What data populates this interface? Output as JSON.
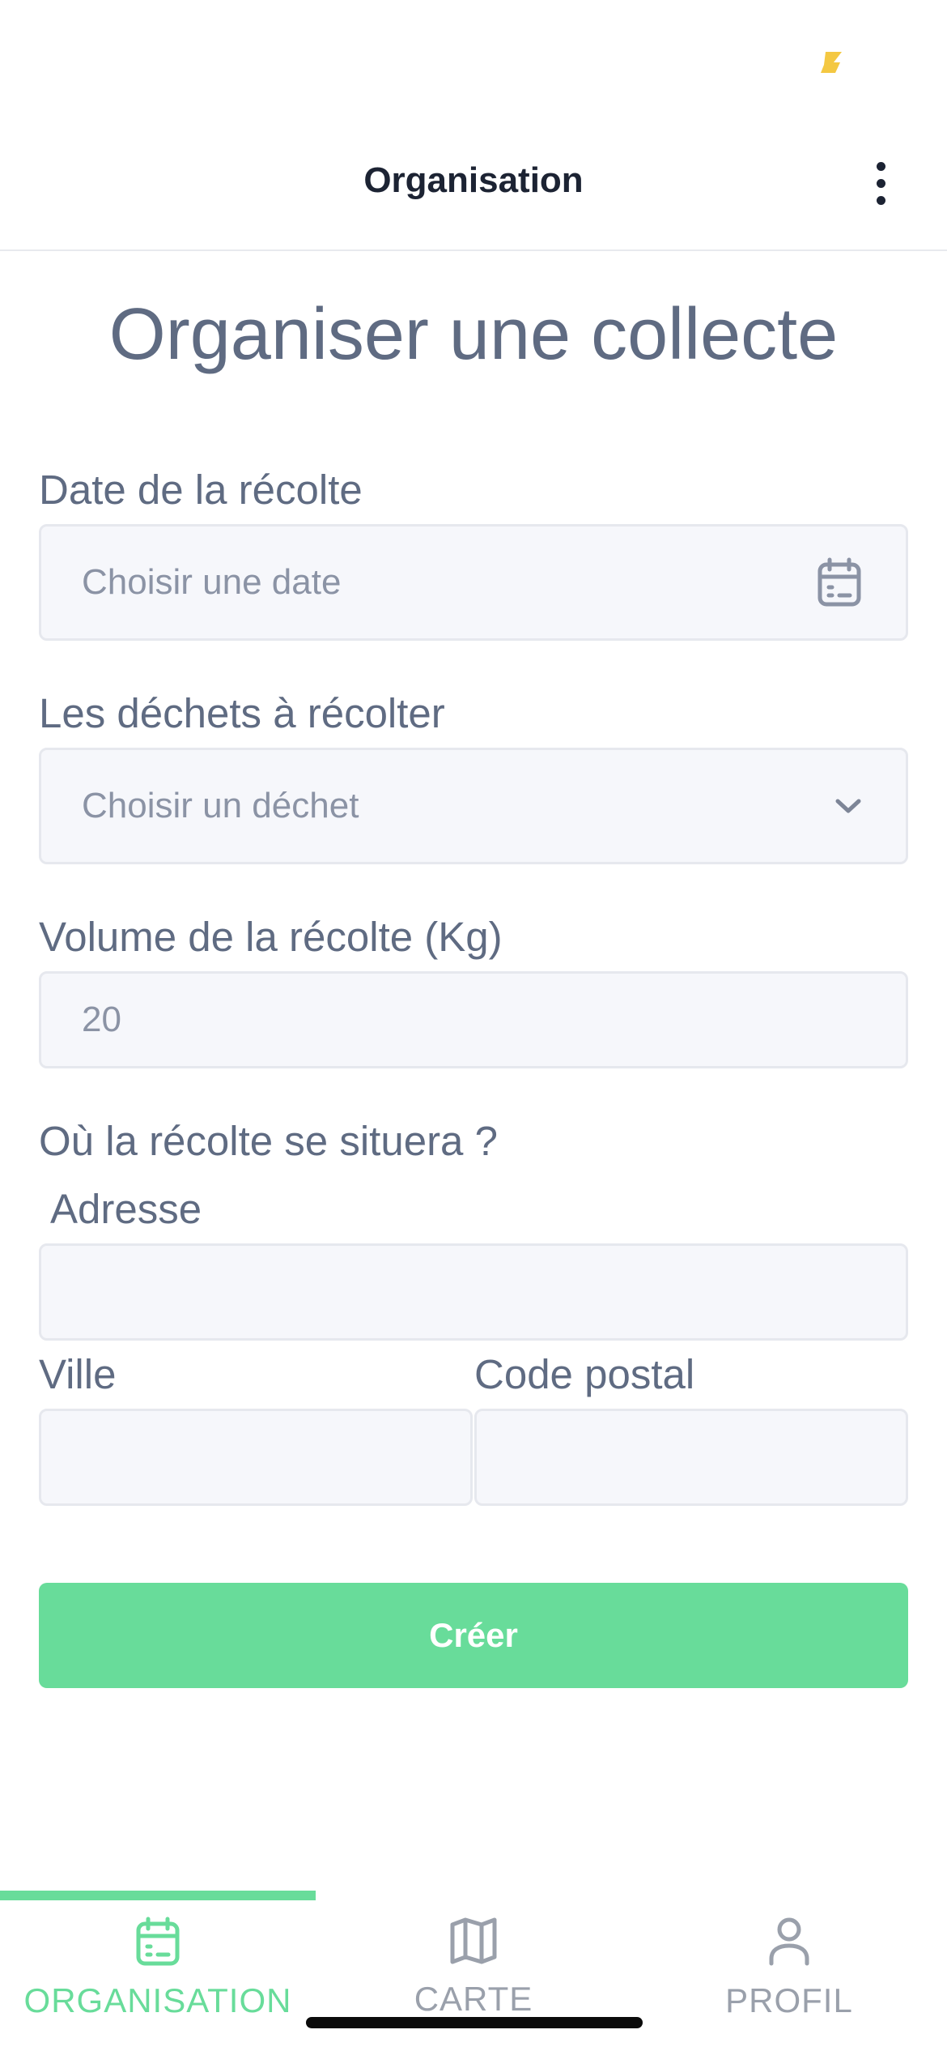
{
  "colors": {
    "accent": "#68dc9a",
    "text_primary": "#5f6b82",
    "header_text": "#1c2333",
    "input_bg": "#f6f7fb",
    "tab_inactive": "#9aa0ab",
    "status_indicator": "#f4c842"
  },
  "header": {
    "title": "Organisation",
    "menu_icon": "more-vertical-icon"
  },
  "form": {
    "title": "Organiser une collecte",
    "date": {
      "label": "Date de la récolte",
      "placeholder": "Choisir une date",
      "icon": "calendar-icon"
    },
    "waste": {
      "label": "Les déchets à récolter",
      "placeholder": "Choisir un déchet",
      "icon": "chevron-down-icon"
    },
    "volume": {
      "label": "Volume de la récolte (Kg)",
      "placeholder": "20"
    },
    "location": {
      "label": "Où la récolte se situera ?",
      "address_label": "Adresse",
      "address_value": "",
      "city_label": "Ville",
      "city_value": "",
      "postal_label": "Code postal",
      "postal_value": ""
    },
    "submit_label": "Créer"
  },
  "tabs": [
    {
      "label": "ORGANISATION",
      "icon": "calendar-icon",
      "active": true
    },
    {
      "label": "CARTE",
      "icon": "map-icon",
      "active": false
    },
    {
      "label": "PROFIL",
      "icon": "user-icon",
      "active": false
    }
  ]
}
